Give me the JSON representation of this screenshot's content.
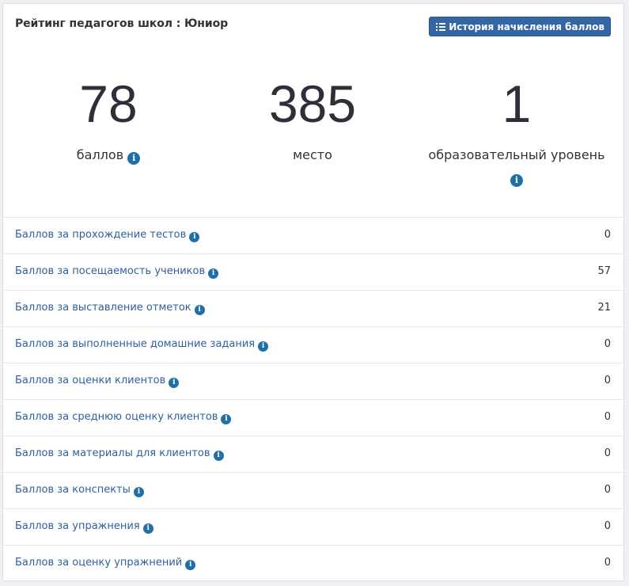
{
  "card": {
    "title": "Рейтинг педагогов школ : Юниор",
    "history_button_label": "История начисления баллов"
  },
  "stats": [
    {
      "value": "78",
      "label": "баллов",
      "has_info": true
    },
    {
      "value": "385",
      "label": "место",
      "has_info": false
    },
    {
      "value": "1",
      "label": "образовательный уровень",
      "has_info": true
    }
  ],
  "rows": [
    {
      "label": "Баллов за прохождение тестов",
      "value": "0"
    },
    {
      "label": "Баллов за посещаемость учеников",
      "value": "57"
    },
    {
      "label": "Баллов за выставление отметок",
      "value": "21"
    },
    {
      "label": "Баллов за выполненные домашние задания",
      "value": "0"
    },
    {
      "label": "Баллов за оценки клиентов",
      "value": "0"
    },
    {
      "label": "Баллов за среднюю оценку клиентов",
      "value": "0"
    },
    {
      "label": "Баллов за материалы для клиентов",
      "value": "0"
    },
    {
      "label": "Баллов за конспекты",
      "value": "0"
    },
    {
      "label": "Баллов за упражнения",
      "value": "0"
    },
    {
      "label": "Баллов за оценку упражнений",
      "value": "0"
    }
  ],
  "icons": {
    "info": "info-icon",
    "list": "list-icon"
  },
  "colors": {
    "button_bg": "#3466a6",
    "info_icon": "#1f6fa8",
    "link_text": "#2f5f9e"
  }
}
